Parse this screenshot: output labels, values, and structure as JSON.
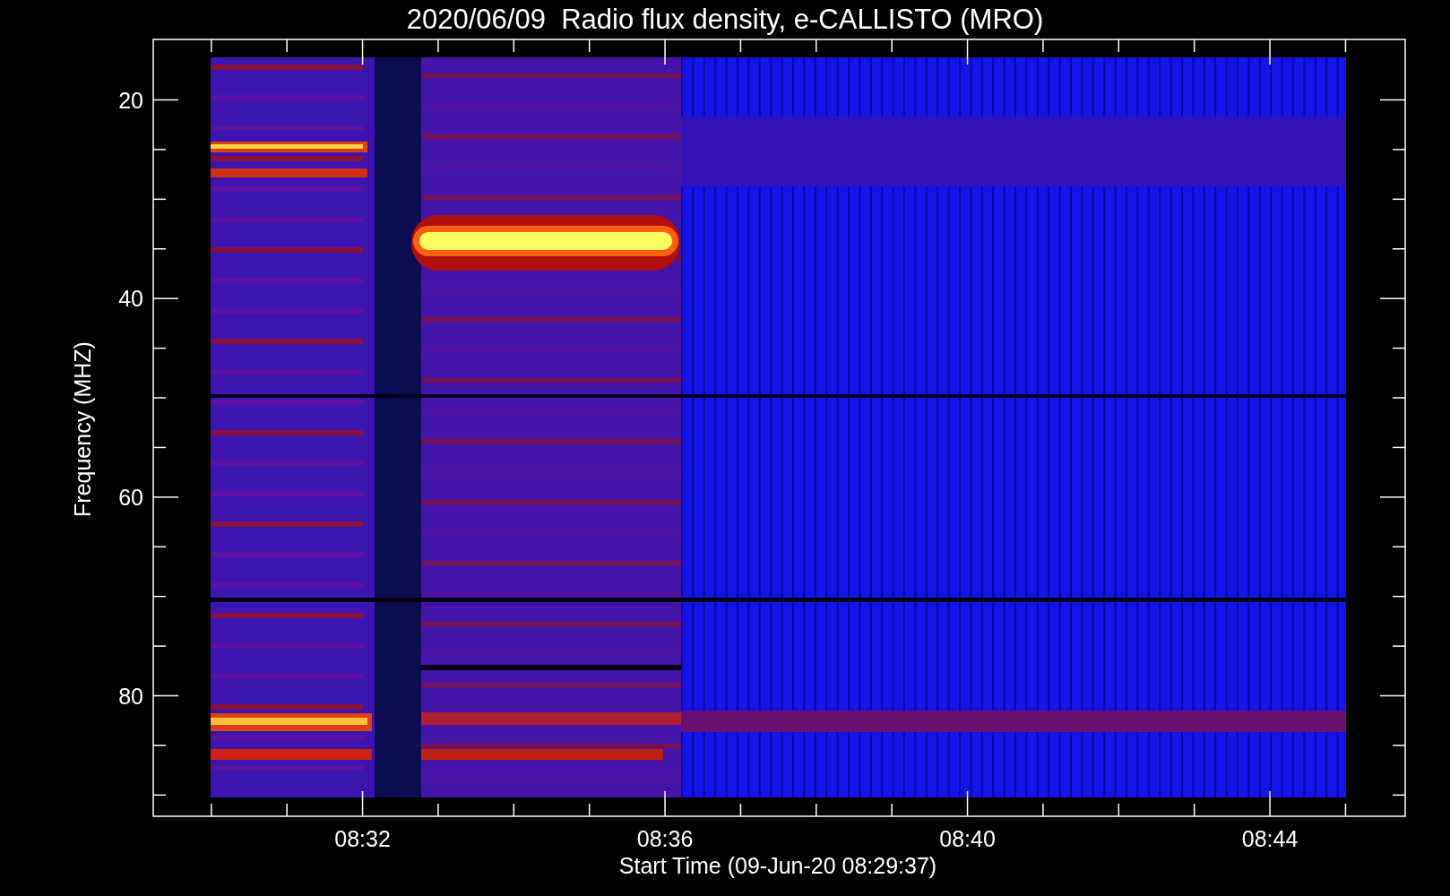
{
  "title": "2020/06/09  Radio flux density, e-CALLISTO (MRO)",
  "y_axis": {
    "label": "Frequency (MHZ)",
    "ticks": [
      "20",
      "40",
      "60",
      "80"
    ]
  },
  "x_axis": {
    "label": "Start Time (09-Jun-20 08:29:37)",
    "ticks": [
      "08:32",
      "08:36",
      "08:40",
      "08:44"
    ]
  }
}
